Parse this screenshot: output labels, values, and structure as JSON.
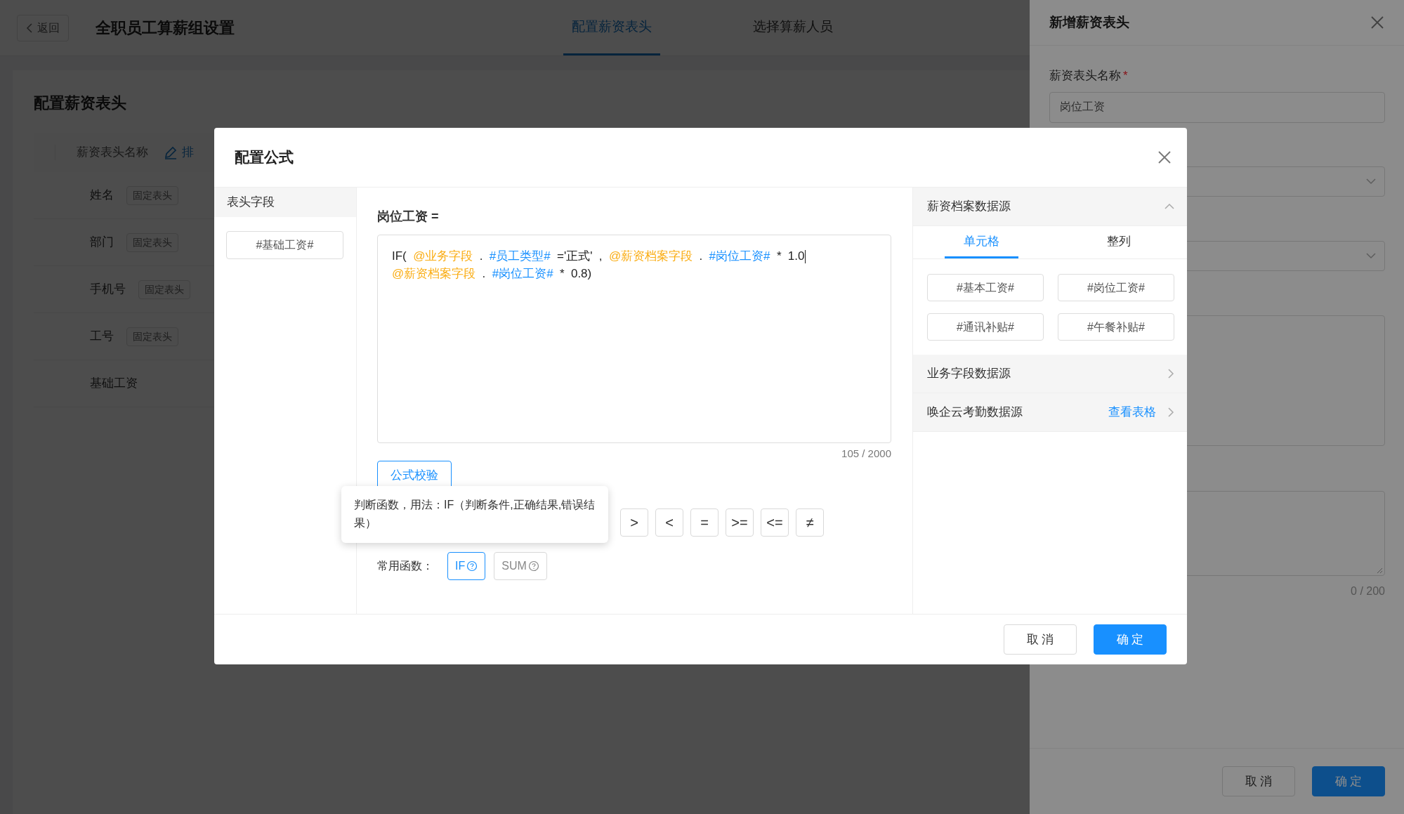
{
  "page": {
    "back_button": "返回",
    "title": "全职员工算薪组设置",
    "tabs": [
      {
        "label": "配置薪资表头",
        "selected": true
      },
      {
        "label": "选择算薪人员",
        "selected": false
      }
    ],
    "card": {
      "title": "配置薪资表头",
      "column": "薪资表头名称",
      "sort_link": "排",
      "rows": [
        {
          "name": "姓名",
          "tag": "固定表头"
        },
        {
          "name": "部门",
          "tag": "固定表头"
        },
        {
          "name": "手机号",
          "tag": "固定表头"
        },
        {
          "name": "工号",
          "tag": "固定表头"
        },
        {
          "name": "基础工资"
        }
      ]
    }
  },
  "drawer": {
    "title": "新增薪资表头",
    "fields": [
      {
        "kind": "input",
        "label": "薪资表头名称",
        "required": true,
        "value": "岗位工资"
      },
      {
        "kind": "select"
      },
      {
        "kind": "select"
      },
      {
        "kind": "textarea"
      },
      {
        "kind": "textarea",
        "counter": "0 / 200"
      }
    ],
    "buttons": [
      {
        "label": "取 消",
        "kind": "default"
      },
      {
        "label": "确 定",
        "kind": "primary"
      }
    ]
  },
  "modal": {
    "title": "配置公式",
    "header_fields": {
      "title": "表头字段",
      "items": [
        "#基础工资#"
      ]
    },
    "formula": {
      "label": "岗位工资 =",
      "counter": "105 / 2000",
      "validate_button": "公式校验",
      "tokens": [
        {
          "kind": "text",
          "text": "IF(",
          "caret": false
        },
        {
          "kind": "source",
          "text": "@业务字段",
          "caret": false
        },
        {
          "kind": "text",
          "text": ".",
          "caret": false
        },
        {
          "kind": "field",
          "text": "#员工类型#",
          "caret": false
        },
        {
          "kind": "text",
          "text": "='正式'",
          "caret": false
        },
        {
          "kind": "text",
          "text": ",",
          "caret": false
        },
        {
          "kind": "source",
          "text": "@薪资档案字段",
          "caret": false
        },
        {
          "kind": "text",
          "text": ".",
          "caret": false
        },
        {
          "kind": "field",
          "text": "#岗位工资#",
          "caret": false
        },
        {
          "kind": "text",
          "text": "*",
          "caret": false
        },
        {
          "kind": "text",
          "text": "1.0",
          "caret": true
        },
        {
          "kind": "source",
          "text": "@薪资档案字段",
          "caret": false
        },
        {
          "kind": "text",
          "text": ".",
          "caret": false
        },
        {
          "kind": "field",
          "text": "#岗位工资#",
          "caret": false
        },
        {
          "kind": "text",
          "text": "*",
          "caret": false
        },
        {
          "kind": "text",
          "text": "0.8)",
          "caret": false
        }
      ]
    },
    "operators": [
      ">",
      "<",
      "=",
      ">=",
      "<=",
      "≠"
    ],
    "functions_label": "常用函数：",
    "functions": [
      {
        "label": "IF",
        "selected": true
      },
      {
        "label": "SUM",
        "selected": false
      }
    ],
    "tooltip": "判断函数，用法：IF（判断条件,正确结果,错误结果）",
    "sources": [
      {
        "title": "薪资档案数据源",
        "expanded": true,
        "tabs": [
          {
            "label": "单元格",
            "selected": true
          },
          {
            "label": "整列",
            "selected": false
          }
        ],
        "items": [
          "#基本工资#",
          "#岗位工资#",
          "#通讯补贴#",
          "#午餐补贴#"
        ]
      },
      {
        "title": "业务字段数据源",
        "expanded": false
      },
      {
        "title": "唤企云考勤数据源",
        "expanded": false,
        "link": "查看表格"
      }
    ],
    "buttons": [
      {
        "label": "取 消",
        "kind": "default"
      },
      {
        "label": "确 定",
        "kind": "primary"
      }
    ]
  }
}
